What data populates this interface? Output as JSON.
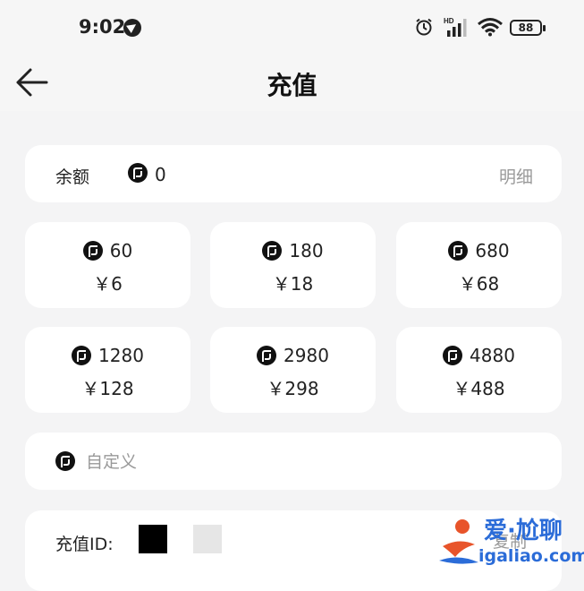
{
  "status_bar": {
    "time": "9:02",
    "battery": "88",
    "network": "HD"
  },
  "header": {
    "title": "充值"
  },
  "balance": {
    "label": "余额",
    "value": "0",
    "detail_label": "明细"
  },
  "packages": [
    {
      "coins": "60",
      "price": "￥6"
    },
    {
      "coins": "180",
      "price": "￥18"
    },
    {
      "coins": "680",
      "price": "￥68"
    },
    {
      "coins": "1280",
      "price": "￥128"
    },
    {
      "coins": "2980",
      "price": "￥298"
    },
    {
      "coins": "4880",
      "price": "￥488"
    }
  ],
  "custom": {
    "placeholder": "自定义",
    "value": ""
  },
  "recharge_id": {
    "label": "充值ID:",
    "copy_label": "复制"
  },
  "watermark": {
    "top_text": "爱·尬聊",
    "bottom_text": "igaliao.com"
  },
  "colors": {
    "background": "#f4f4f5",
    "card": "#ffffff",
    "text": "#222222",
    "muted": "#999999",
    "watermark": "#2b6cd8"
  }
}
